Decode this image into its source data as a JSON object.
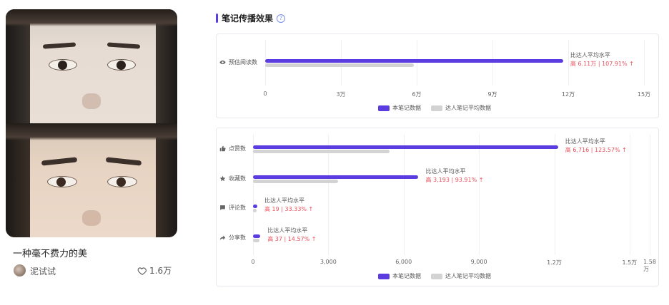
{
  "post": {
    "title": "一种毫不费力的美",
    "author": "泥试试",
    "likes": "1.6万",
    "image_icon": "portrait-photo"
  },
  "section": {
    "title": "笔记传播效果",
    "help_icon": "question-circle-icon"
  },
  "colors": {
    "main": "#5b3ce0",
    "avg": "#d3d3d3",
    "up": "#e8505b"
  },
  "chart_data": [
    {
      "type": "bar",
      "orientation": "horizontal",
      "categories": [
        "预估阅读数"
      ],
      "series": [
        {
          "name": "本笔记数据",
          "values": [
            118000
          ]
        },
        {
          "name": "达人笔记平均数据",
          "values": [
            59000
          ]
        }
      ],
      "x_ticks": [
        "0",
        "3万",
        "6万",
        "9万",
        "12万",
        "15万"
      ],
      "xlim": [
        0,
        150000
      ],
      "annotations": [
        {
          "label": "比达人平均水平",
          "delta": "高 6.11万 | 107.91% ↑"
        }
      ],
      "legend": "bottom"
    },
    {
      "type": "bar",
      "orientation": "horizontal",
      "categories": [
        "点赞数",
        "收藏数",
        "评论数",
        "分享数"
      ],
      "series": [
        {
          "name": "本笔记数据",
          "values": [
            12150,
            6590,
            76,
            291
          ]
        },
        {
          "name": "达人笔记平均数据",
          "values": [
            5434,
            3397,
            57,
            254
          ]
        }
      ],
      "x_ticks": [
        "0",
        "3,000",
        "6,000",
        "9,000",
        "1.2万",
        "1.5万",
        "1.58万"
      ],
      "xlim": [
        0,
        15800
      ],
      "annotations": [
        {
          "label": "比达人平均水平",
          "delta": "高 6,716 | 123.57% ↑"
        },
        {
          "label": "比达人平均水平",
          "delta": "高 3,193 | 93.91% ↑"
        },
        {
          "label": "比达人平均水平",
          "delta": "高 19 | 33.33% ↑"
        },
        {
          "label": "比达人平均水平",
          "delta": "高 37 | 14.57% ↑"
        }
      ],
      "legend": "bottom"
    }
  ]
}
